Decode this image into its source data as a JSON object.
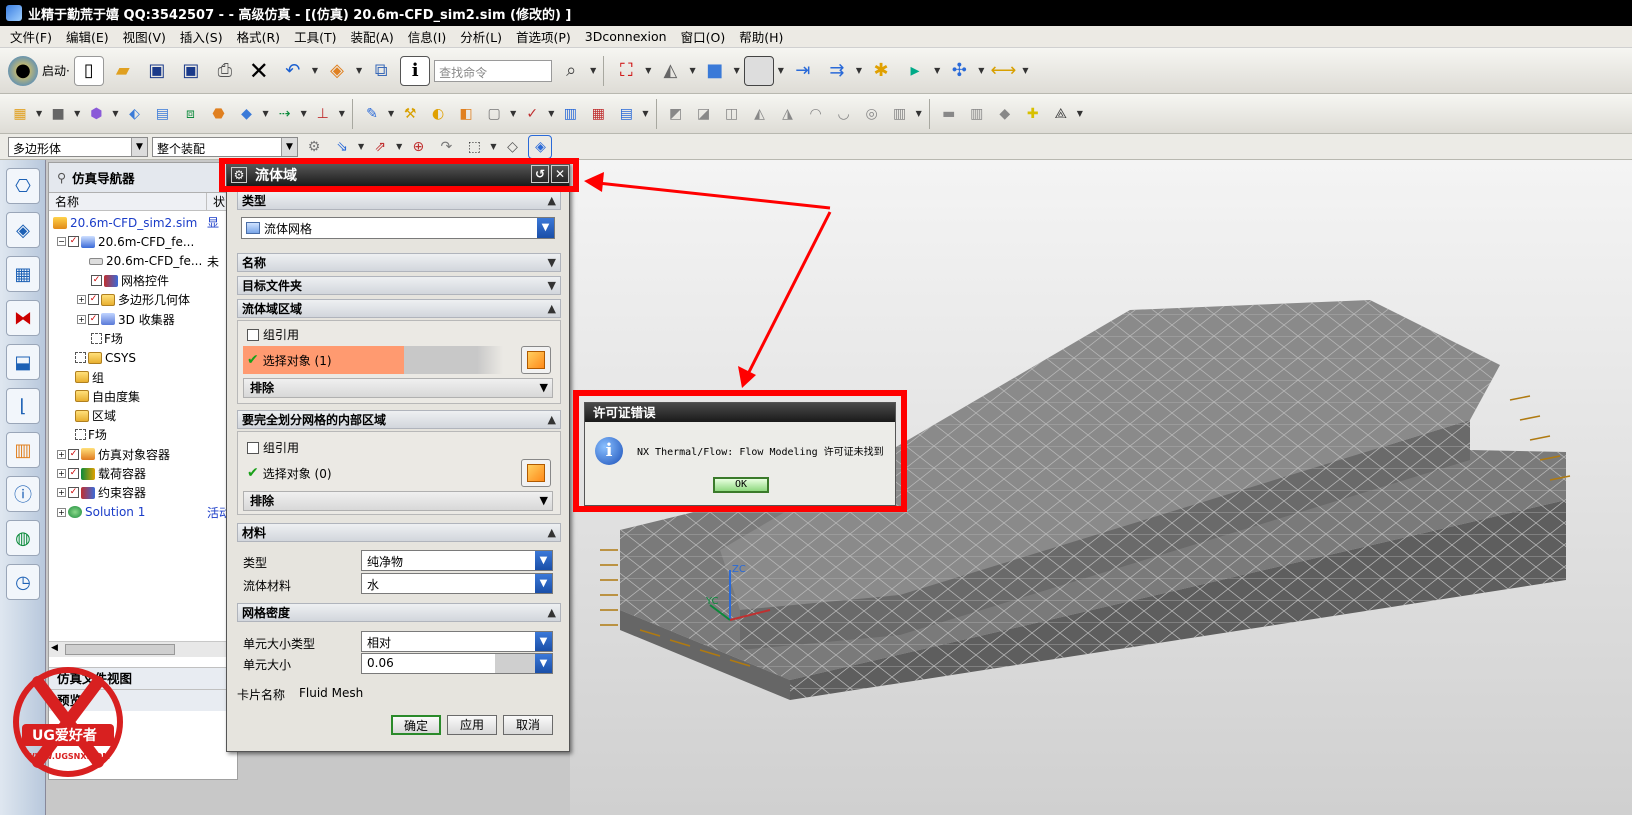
{
  "window": {
    "title": "业精于勤荒于嬉 QQ:3542507 - - 高级仿真 - [(仿真) 20.6m-CFD_sim2.sim  (修改的) ]"
  },
  "menu": [
    "文件(F)",
    "编辑(E)",
    "视图(V)",
    "插入(S)",
    "格式(R)",
    "工具(T)",
    "装配(A)",
    "信息(I)",
    "分析(L)",
    "首选项(P)",
    "3Dconnexion",
    "窗口(O)",
    "帮助(H)"
  ],
  "toolbar": {
    "start_label": "启动·",
    "search_placeholder": "查找命令"
  },
  "selection_bar": {
    "filter": "多边形体",
    "scope": "整个装配"
  },
  "navigator": {
    "title": "仿真导航器",
    "columns": [
      "名称",
      "状"
    ],
    "rows": [
      {
        "label": "20.6m-CFD_sim2.sim",
        "status": "显",
        "indent": 0
      },
      {
        "label": "20.6m-CFD_fe...",
        "status": "",
        "indent": 1
      },
      {
        "label": "20.6m-CFD_fe...",
        "status": "未",
        "indent": 2
      },
      {
        "label": "网格控件",
        "status": "",
        "indent": 2
      },
      {
        "label": "多边形几何体",
        "status": "",
        "indent": 2
      },
      {
        "label": "3D 收集器",
        "status": "",
        "indent": 2
      },
      {
        "label": "F场",
        "status": "",
        "indent": 2
      },
      {
        "label": "CSYS",
        "status": "",
        "indent": 1
      },
      {
        "label": "组",
        "status": "",
        "indent": 1
      },
      {
        "label": "自由度集",
        "status": "",
        "indent": 1
      },
      {
        "label": "区域",
        "status": "",
        "indent": 1
      },
      {
        "label": "F场",
        "status": "",
        "indent": 1
      },
      {
        "label": "仿真对象容器",
        "status": "",
        "indent": 0
      },
      {
        "label": "载荷容器",
        "status": "",
        "indent": 0
      },
      {
        "label": "约束容器",
        "status": "",
        "indent": 0
      },
      {
        "label": "Solution 1",
        "status": "活动",
        "indent": 0
      }
    ],
    "bottom_panels": [
      "仿真文件视图",
      "预览"
    ]
  },
  "dialog": {
    "title": "流体域",
    "sections": {
      "type": "类型",
      "name": "名称",
      "target_folder": "目标文件夹",
      "fluid_region": "流体域区域",
      "internal": "要完全划分网格的内部区域",
      "material": "材料",
      "density": "网格密度"
    },
    "type_value": "流体网格",
    "group_ref": "组引用",
    "select_object_1": "选择对象 (1)",
    "select_object_0": "选择对象 (0)",
    "exclude": "排除",
    "material_type_label": "类型",
    "material_type_value": "纯净物",
    "fluid_material_label": "流体材料",
    "fluid_material_value": "水",
    "elem_size_type_label": "单元大小类型",
    "elem_size_type_value": "相对",
    "elem_size_label": "单元大小",
    "elem_size_value": "0.06",
    "card_name_label": "卡片名称",
    "card_name_value": "Fluid Mesh",
    "ok": "确定",
    "apply": "应用",
    "cancel": "取消"
  },
  "error_dialog": {
    "title": "许可证错误",
    "message": "NX Thermal/Flow: Flow Modeling 许可证未找到",
    "ok": "OK"
  },
  "viewport": {
    "axis_labels": [
      "ZC",
      "YC"
    ]
  },
  "watermark": {
    "brand": "UG爱好者",
    "url": "WWW.UGSNX.COM"
  }
}
